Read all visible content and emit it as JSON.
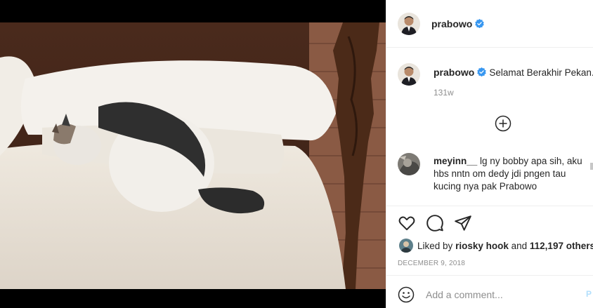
{
  "post": {
    "username": "prabowo",
    "caption": "Selamat Berakhir Pekan.",
    "age": "131w",
    "image_subject": "white and black cat on a bed"
  },
  "comment": {
    "username": "meyinn__",
    "text": "lg ny bobby apa sih, aku hbs nntn om dedy jdi pngen tau kucing nya pak Prabowo"
  },
  "likes": {
    "prefix": "Liked by",
    "user": "riosky hook",
    "and": "and",
    "count": "112,197 others"
  },
  "date": "DECEMBER 9, 2018",
  "add_comment": {
    "placeholder": "Add a comment...",
    "post_label": "P"
  },
  "colors": {
    "verified": "#3897f0",
    "muted": "#8e8e8e",
    "border": "#efefef"
  }
}
